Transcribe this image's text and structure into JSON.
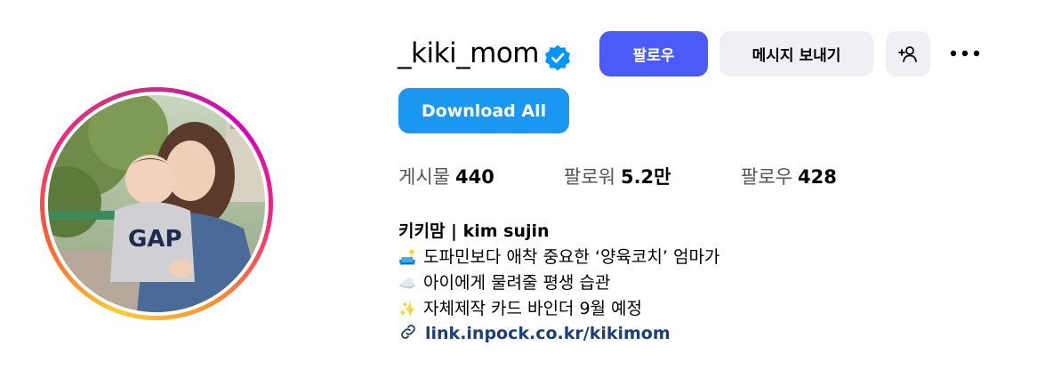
{
  "profile": {
    "username": "_kiki_mom",
    "verified": true,
    "accent_color": "#4a5cf5"
  },
  "actions": {
    "follow_label": "팔로우",
    "message_label": "메시지 보내기",
    "add_user_icon": "person-plus-icon",
    "more_icon": "ellipsis-icon",
    "download_label": "Download All"
  },
  "stats": {
    "posts_label": "게시물",
    "posts_value": "440",
    "followers_label": "팔로워",
    "followers_value": "5.2만",
    "following_label": "팔로우",
    "following_value": "428"
  },
  "bio": {
    "name": "키키맘 | kim sujin",
    "lines": [
      {
        "emoji": "🛋️",
        "text": "도파민보다 애착 중요한 ‘양육코치’ 엄마가"
      },
      {
        "emoji": "☁️",
        "text": "아이에게 물려줄 평생 습관"
      },
      {
        "emoji": "✨",
        "text": "자체제작 카드 바인더 9월 예정"
      }
    ],
    "link": "link.inpock.co.kr/kikimom"
  }
}
